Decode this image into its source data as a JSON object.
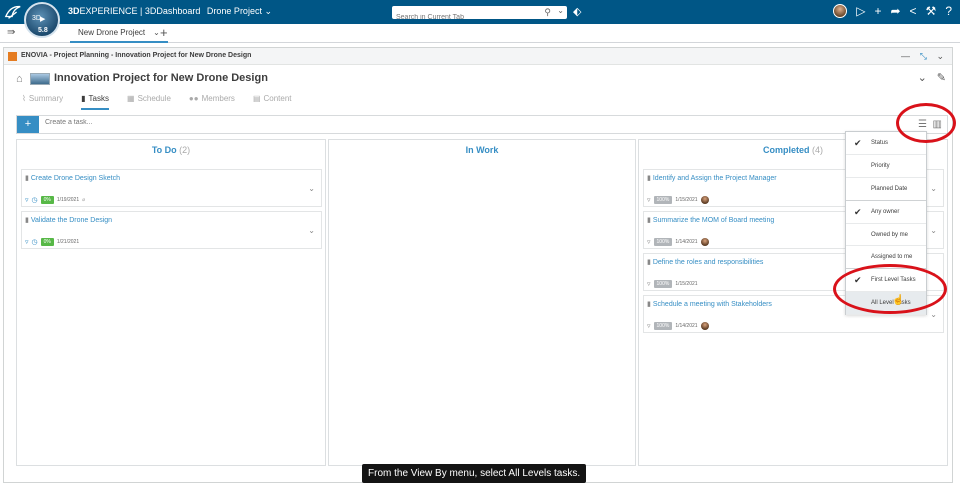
{
  "topbar": {
    "brand_bold": "3D",
    "brand_rest": "EXPERIENCE | 3DDashboard",
    "dashboard_name": "Drone Project",
    "compass_version": "5.8",
    "search_placeholder": "Search in Current Tab"
  },
  "tabbar": {
    "active_tab": "New Drone Project"
  },
  "widget": {
    "title": "ENOVIA - Project Planning - Innovation Project for New Drone Design",
    "project_title": "Innovation Project for New Drone Design",
    "nav_tabs": [
      {
        "label": "Summary",
        "icon": "chart-icon"
      },
      {
        "label": "Tasks",
        "icon": "tasks-icon"
      },
      {
        "label": "Schedule",
        "icon": "calendar-icon"
      },
      {
        "label": "Members",
        "icon": "members-icon"
      },
      {
        "label": "Content",
        "icon": "document-icon"
      }
    ],
    "create_placeholder": "Create a task..."
  },
  "columns": [
    {
      "name": "To Do",
      "count": "(2)",
      "cards": [
        {
          "title": "Create Drone Design Sketch",
          "percent": "0%",
          "percent_value": 0,
          "date": "1/19/2021"
        },
        {
          "title": "Validate the Drone Design",
          "percent": "0%",
          "percent_value": 0,
          "date": "1/21/2021"
        }
      ]
    },
    {
      "name": "In Work",
      "count": "",
      "cards": []
    },
    {
      "name": "Completed",
      "count": "(4)",
      "cards": [
        {
          "title": "Identify and Assign the Project Manager",
          "percent": "100%",
          "percent_value": 100,
          "date": "1/15/2021"
        },
        {
          "title": "Summarize the MOM of Board meeting",
          "percent": "100%",
          "percent_value": 100,
          "date": "1/14/2021"
        },
        {
          "title": "Define the roles and responsibilities",
          "percent": "100%",
          "percent_value": 100,
          "date": "1/15/2021"
        },
        {
          "title": "Schedule a meeting with Stakeholders",
          "percent": "100%",
          "percent_value": 100,
          "date": "1/14/2021"
        }
      ]
    }
  ],
  "view_menu": {
    "items": [
      {
        "label": "Status",
        "checked": true
      },
      {
        "label": "Priority",
        "checked": false
      },
      {
        "label": "Planned Date",
        "checked": false
      },
      {
        "label": "Any owner",
        "checked": true
      },
      {
        "label": "Owned by me",
        "checked": false
      },
      {
        "label": "Assigned to me",
        "checked": false
      },
      {
        "label": "First Level Tasks",
        "checked": true
      },
      {
        "label": "All Level Tasks",
        "checked": false
      }
    ]
  },
  "caption": "From the View By menu, select All Levels tasks.",
  "colors": {
    "topbar": "#005686",
    "accent": "#368ec4",
    "green": "#57b847",
    "annotation_red": "#d9121a"
  }
}
